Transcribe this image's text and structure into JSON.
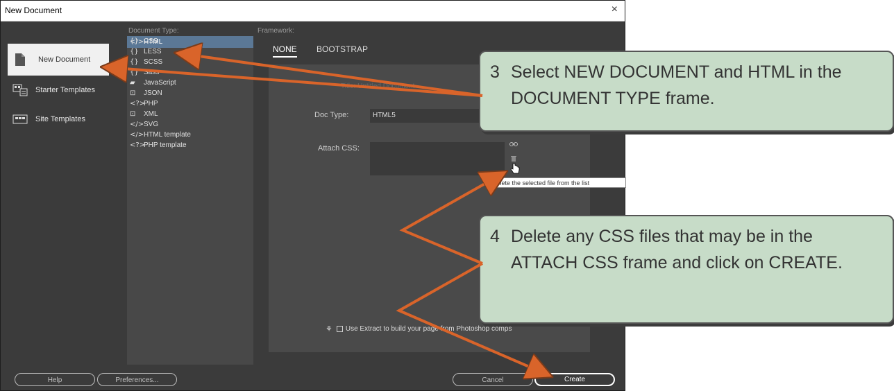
{
  "dialog": {
    "title": "New Document",
    "close_glyph": "×"
  },
  "sidebar": {
    "items": [
      {
        "label": "New Document",
        "icon": "document-icon"
      },
      {
        "label": "Starter Templates",
        "icon": "starter-templates-icon"
      },
      {
        "label": "Site Templates",
        "icon": "site-templates-icon"
      }
    ]
  },
  "document_type": {
    "label": "Document Type:",
    "items": [
      {
        "icon": "</>",
        "label": "HTML"
      },
      {
        "icon": "{}",
        "label": "CSS"
      },
      {
        "icon": "{}",
        "label": "LESS"
      },
      {
        "icon": "{}",
        "label": "SCSS"
      },
      {
        "icon": "{}",
        "label": "Sass"
      },
      {
        "icon": "▰",
        "label": "JavaScript"
      },
      {
        "icon": "⊡",
        "label": "JSON"
      },
      {
        "icon": "<?>",
        "label": "PHP"
      },
      {
        "icon": "⊡",
        "label": "XML"
      },
      {
        "icon": "</>",
        "label": "SVG"
      },
      {
        "icon": "</>",
        "label": "HTML template"
      },
      {
        "icon": "<?>",
        "label": "PHP template"
      }
    ],
    "selected": "HTML"
  },
  "framework": {
    "label": "Framework:",
    "tabs": [
      "NONE",
      "BOOTSTRAP"
    ],
    "active_tab": "NONE"
  },
  "panel": {
    "faded_text": "Title:    Untitled Document",
    "doc_type_label": "Doc Type:",
    "doc_type_value": "HTML5",
    "attach_css_label": "Attach CSS:",
    "link_icon": "link-icon",
    "trash_icon": "trash-icon",
    "tooltip": "Delete the selected file from the list",
    "extract_label": "Use Extract to build your page from Photoshop comps"
  },
  "buttons": {
    "help": "Help",
    "preferences": "Preferences...",
    "cancel": "Cancel",
    "create": "Create"
  },
  "callouts": [
    {
      "number": "3",
      "text": "Select NEW DOCUMENT and HTML in the DOCUMENT TYPE frame."
    },
    {
      "number": "4",
      "text": "Delete any CSS files that may be in the ATTACH CSS frame and click on CREATE."
    }
  ],
  "colors": {
    "dialog_bg": "#3b3b3b",
    "selection": "#5b7896",
    "callout_bg": "#c7dcc8",
    "arrow": "#d9642a"
  }
}
